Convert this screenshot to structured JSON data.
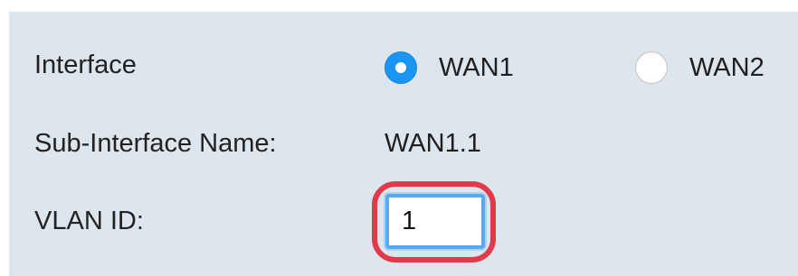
{
  "form": {
    "interface_label": "Interface",
    "interface_options": [
      {
        "label": "WAN1",
        "checked": true
      },
      {
        "label": "WAN2",
        "checked": false
      }
    ],
    "subinterface_label": "Sub-Interface Name:",
    "subinterface_value": "WAN1.1",
    "vlan_label": "VLAN ID:",
    "vlan_value": "1"
  },
  "colors": {
    "panel_background": "#dde6ed",
    "radio_selected": "#1a95f2",
    "highlight_ring": "#e23a4a",
    "input_focus_border": "#5aa8f0"
  }
}
